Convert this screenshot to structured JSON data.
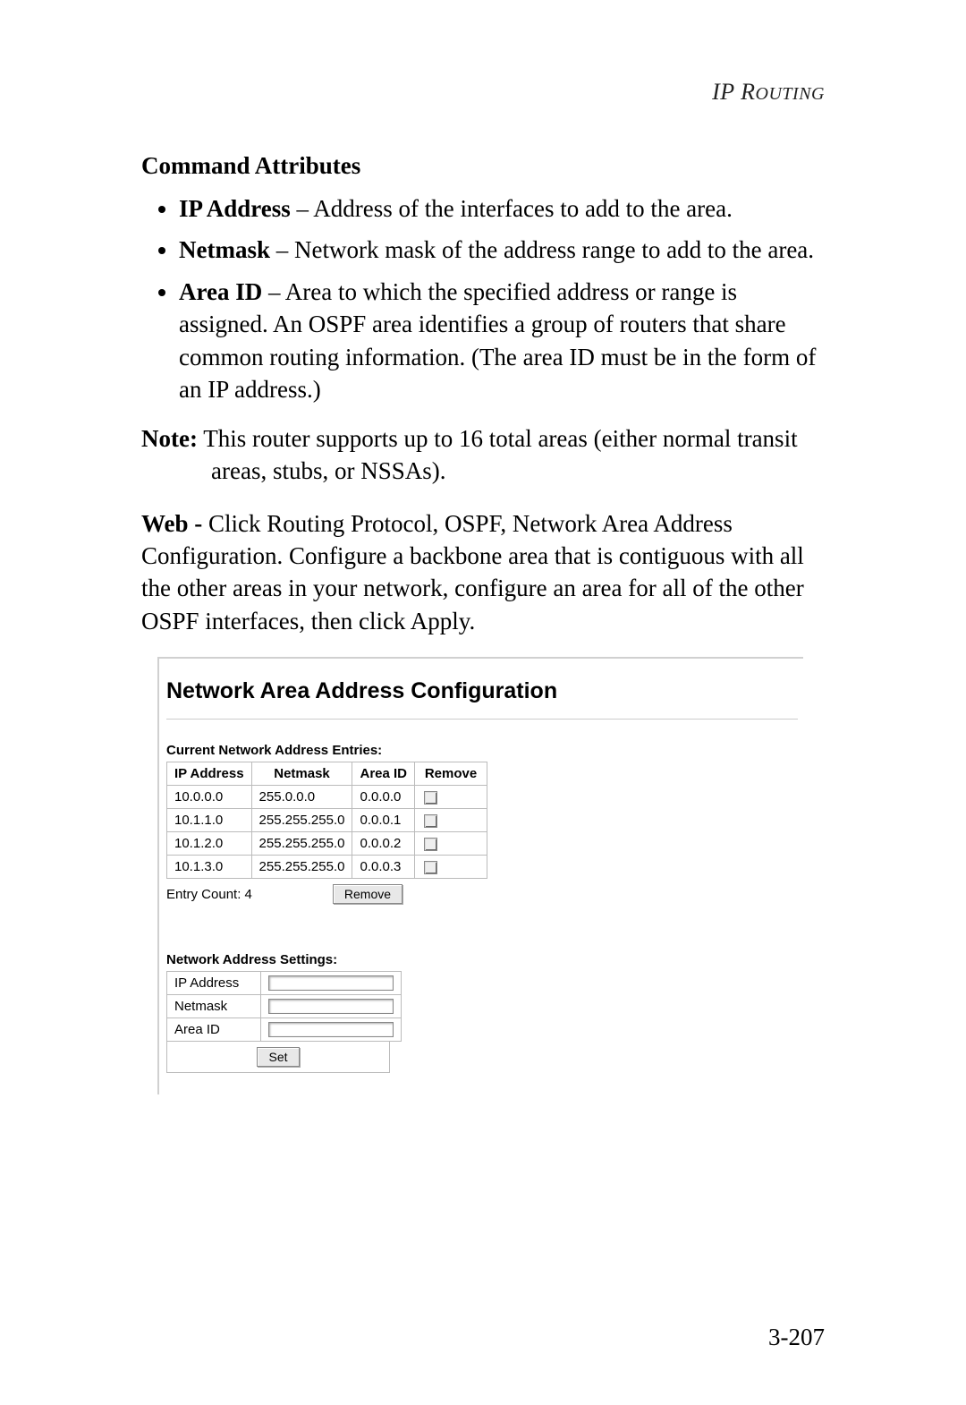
{
  "header": {
    "line": "IP ROUTING"
  },
  "section_title": "Command Attributes",
  "bullets": [
    {
      "term": "IP Address",
      "desc": " – Address of the interfaces to add to the area."
    },
    {
      "term": "Netmask",
      "desc": " – Network mask of the address range to add to the area."
    },
    {
      "term": "Area ID",
      "desc": " – Area to which the specified address or range is assigned. An OSPF area identifies a group of routers that share common routing information. (The area ID must be in the form of an IP address.)"
    }
  ],
  "note": {
    "label": "Note:",
    "text": "  This router supports up to 16 total areas (either normal transit areas, stubs, or NSSAs)."
  },
  "web_para": {
    "leader": "Web -",
    "text": " Click Routing Protocol, OSPF, Network Area Address Configuration. Configure a backbone area that is contiguous with all the other areas in your network, configure an area for all of the other OSPF interfaces, then click Apply."
  },
  "panel": {
    "title": "Network Area Address Configuration",
    "entries_heading": "Current Network Address Entries:",
    "columns": {
      "c0": "IP Address",
      "c1": "Netmask",
      "c2": "Area ID",
      "c3": "Remove"
    },
    "rows": [
      {
        "ip": "10.0.0.0",
        "mask": "255.0.0.0",
        "area": "0.0.0.0"
      },
      {
        "ip": "10.1.1.0",
        "mask": "255.255.255.0",
        "area": "0.0.0.1"
      },
      {
        "ip": "10.1.2.0",
        "mask": "255.255.255.0",
        "area": "0.0.0.2"
      },
      {
        "ip": "10.1.3.0",
        "mask": "255.255.255.0",
        "area": "0.0.0.3"
      }
    ],
    "entry_count_label": "Entry Count: 4",
    "remove_btn": "Remove",
    "settings_heading": "Network Address Settings:",
    "settings_rows": {
      "ip": "IP Address",
      "mask": "Netmask",
      "area": "Area ID"
    },
    "set_btn": "Set"
  },
  "page_number": "3-207"
}
